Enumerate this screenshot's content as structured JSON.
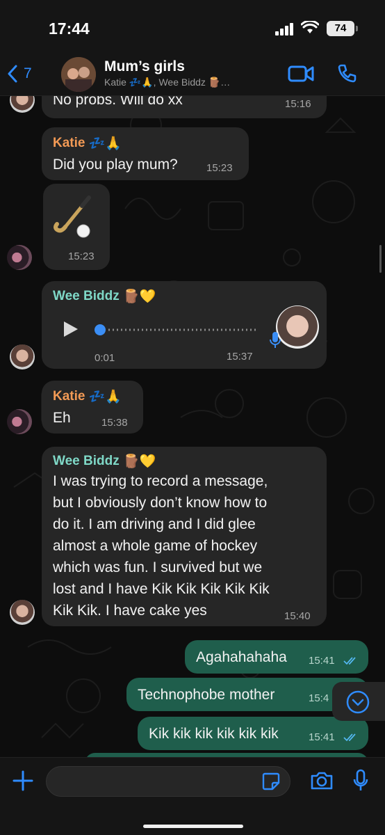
{
  "status": {
    "time": "17:44",
    "battery": "74"
  },
  "header": {
    "back_count": "7",
    "title": "Mum’s girls",
    "subtitle": "Katie 💤🙏, Wee Biddz 🪵…"
  },
  "messages": [
    {
      "type": "incoming",
      "text": "No probs. Will do xx",
      "time": "15:16"
    },
    {
      "type": "incoming",
      "sender": "Katie",
      "sender_emoji": "💤🙏",
      "text": "Did you play mum?",
      "time": "15:23"
    },
    {
      "type": "incoming",
      "sticker": "🏑",
      "time": "15:23"
    },
    {
      "type": "voice",
      "sender": "Wee Biddz",
      "sender_emoji": "🪵💛",
      "duration": "0:01",
      "time": "15:37"
    },
    {
      "type": "incoming",
      "sender": "Katie",
      "sender_emoji": "💤🙏",
      "text": "Eh",
      "time": "15:38"
    },
    {
      "type": "incoming",
      "sender": "Wee Biddz",
      "sender_emoji": "🪵💛",
      "lines": [
        "I was trying to record a message,",
        "but I obviously don’t know how to",
        "do it. I am driving and I did glee",
        "almost a whole game of hockey",
        "which was fun. I survived but we",
        "lost and I have Kik Kik Kik Kik Kik",
        "Kik Kik. I have cake yes"
      ],
      "time": "15:40"
    },
    {
      "type": "outgoing",
      "text": "Agahahahaha",
      "time": "15:41"
    },
    {
      "type": "outgoing",
      "text": "Technophobe mother",
      "time": "15:4"
    },
    {
      "type": "outgoing",
      "text": "Kik kik kik kik kik kik",
      "time": "15:41"
    }
  ],
  "composer": {
    "placeholder": ""
  },
  "colors": {
    "accent": "#2f8cff",
    "outgoing_bubble": "#1f5e4c",
    "incoming_bubble": "#262626",
    "katie": "#f39a55",
    "biddz": "#7fd8c7"
  }
}
